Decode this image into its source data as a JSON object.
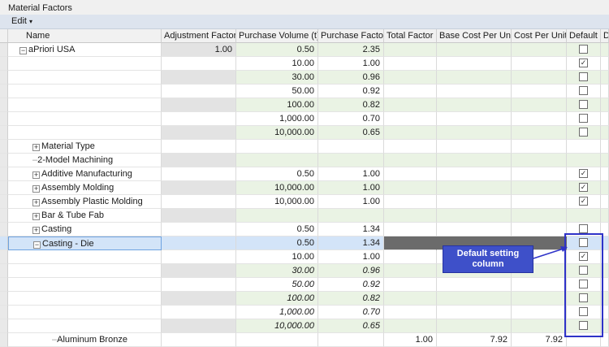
{
  "window": {
    "title": "Material Factors"
  },
  "menu": {
    "edit_label": "Edit",
    "edit_caret": "▾"
  },
  "columns": {
    "name": "Name",
    "adjustment_factor": "Adjustment Factor",
    "purchase_volume": "Purchase Volume (t)",
    "purchase_factor": "Purchase Factor",
    "total_factor": "Total Factor",
    "base_cost_per_unit": "Base Cost Per Unit",
    "cost_per_unit": "Cost Per Unit",
    "default": "Default",
    "extra": "D"
  },
  "rows": [
    {
      "name": "aPriori USA",
      "exp": "⊟",
      "adj": "1.00",
      "vol": "0.50",
      "pf": "2.35",
      "tot": "",
      "base": "",
      "cpu": "",
      "check": "box",
      "checked": false
    },
    {
      "name": "",
      "exp": "",
      "adj": "",
      "vol": "10.00",
      "pf": "1.00",
      "tot": "",
      "base": "",
      "cpu": "",
      "check": "box",
      "checked": true
    },
    {
      "name": "",
      "exp": "",
      "adj": "",
      "vol": "30.00",
      "pf": "0.96",
      "tot": "",
      "base": "",
      "cpu": "",
      "check": "box",
      "checked": false
    },
    {
      "name": "",
      "exp": "",
      "adj": "",
      "vol": "50.00",
      "pf": "0.92",
      "tot": "",
      "base": "",
      "cpu": "",
      "check": "box",
      "checked": false
    },
    {
      "name": "",
      "exp": "",
      "adj": "",
      "vol": "100.00",
      "pf": "0.82",
      "tot": "",
      "base": "",
      "cpu": "",
      "check": "box",
      "checked": false
    },
    {
      "name": "",
      "exp": "",
      "adj": "",
      "vol": "1,000.00",
      "pf": "0.70",
      "tot": "",
      "base": "",
      "cpu": "",
      "check": "box",
      "checked": false
    },
    {
      "name": "",
      "exp": "",
      "adj": "",
      "vol": "10,000.00",
      "pf": "0.65",
      "tot": "",
      "base": "",
      "cpu": "",
      "check": "box",
      "checked": false
    },
    {
      "name": "Material Type",
      "exp": "⊞",
      "adj": "",
      "vol": "",
      "pf": "",
      "tot": "",
      "base": "",
      "cpu": "",
      "check": "none",
      "checked": false
    },
    {
      "name": "2-Model Machining",
      "exp": "",
      "adj": "",
      "vol": "",
      "pf": "",
      "tot": "",
      "base": "",
      "cpu": "",
      "check": "none",
      "checked": false
    },
    {
      "name": "Additive Manufacturing",
      "exp": "⊞",
      "adj": "",
      "vol": "0.50",
      "pf": "1.00",
      "tot": "",
      "base": "",
      "cpu": "",
      "check": "box",
      "checked": true
    },
    {
      "name": "Assembly Molding",
      "exp": "⊞",
      "adj": "",
      "vol": "10,000.00",
      "pf": "1.00",
      "tot": "",
      "base": "",
      "cpu": "",
      "check": "box",
      "checked": true
    },
    {
      "name": "Assembly Plastic Molding",
      "exp": "⊞",
      "adj": "",
      "vol": "10,000.00",
      "pf": "1.00",
      "tot": "",
      "base": "",
      "cpu": "",
      "check": "box",
      "checked": true
    },
    {
      "name": "Bar & Tube Fab",
      "exp": "⊞",
      "adj": "",
      "vol": "",
      "pf": "",
      "tot": "",
      "base": "",
      "cpu": "",
      "check": "none",
      "checked": false
    },
    {
      "name": "Casting",
      "exp": "⊞",
      "adj": "",
      "vol": "0.50",
      "pf": "1.34",
      "tot": "",
      "base": "",
      "cpu": "",
      "check": "box",
      "checked": false
    },
    {
      "name": "Casting - Die",
      "exp": "⊟",
      "adj": "",
      "vol": "0.50",
      "pf": "1.34",
      "tot": "",
      "base": "",
      "cpu": "",
      "check": "box",
      "checked": false
    },
    {
      "name": "",
      "exp": "",
      "adj": "",
      "vol": "10.00",
      "pf": "1.00",
      "tot": "",
      "base": "",
      "cpu": "",
      "check": "box",
      "checked": true
    },
    {
      "name": "",
      "exp": "",
      "adj": "",
      "vol": "30.00",
      "pf": "0.96",
      "tot": "",
      "base": "",
      "cpu": "",
      "check": "box",
      "checked": false,
      "italic": true
    },
    {
      "name": "",
      "exp": "",
      "adj": "",
      "vol": "50.00",
      "pf": "0.92",
      "tot": "",
      "base": "",
      "cpu": "",
      "check": "box",
      "checked": false,
      "italic": true
    },
    {
      "name": "",
      "exp": "",
      "adj": "",
      "vol": "100.00",
      "pf": "0.82",
      "tot": "",
      "base": "",
      "cpu": "",
      "check": "box",
      "checked": false,
      "italic": true
    },
    {
      "name": "",
      "exp": "",
      "adj": "",
      "vol": "1,000.00",
      "pf": "0.70",
      "tot": "",
      "base": "",
      "cpu": "",
      "check": "box",
      "checked": false,
      "italic": true
    },
    {
      "name": "",
      "exp": "",
      "adj": "",
      "vol": "10,000.00",
      "pf": "0.65",
      "tot": "",
      "base": "",
      "cpu": "",
      "check": "box",
      "checked": false,
      "italic": true
    },
    {
      "name": "Aluminum Bronze",
      "exp": "",
      "adj": "",
      "vol": "",
      "pf": "",
      "tot": "1.00",
      "base": "7.92",
      "cpu": "7.92",
      "check": "none",
      "checked": false
    }
  ],
  "selected_row_index": 14,
  "callout": {
    "text": "Default setting column"
  },
  "colors": {
    "accent_blue": "#3e50c9",
    "row_highlight": "#d3e4f8"
  }
}
